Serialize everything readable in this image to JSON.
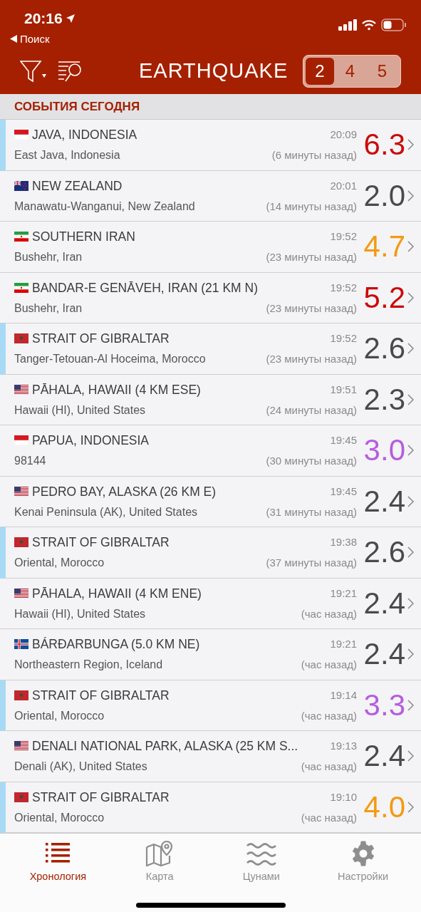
{
  "status_bar": {
    "time": "20:16",
    "back_label": "Поиск"
  },
  "header": {
    "title": "EARTHQUAKE",
    "magnitude_filter": [
      {
        "label": "2",
        "selected": true
      },
      {
        "label": "4",
        "selected": false
      },
      {
        "label": "5",
        "selected": false
      }
    ]
  },
  "section_title": "СОБЫТИЯ СЕГОДНЯ",
  "events": [
    {
      "kind": "id",
      "place": "JAVA, INDONESIA",
      "region": "East Java, Indonesia",
      "time": "20:09",
      "ago": "(6 минуты назад)",
      "magnitude": "6.3",
      "color": "#cc0a0a",
      "marked": true
    },
    {
      "kind": "nz",
      "place": "NEW ZEALAND",
      "region": "Manawatu-Wanganui, New Zealand",
      "time": "20:01",
      "ago": "(14 минуты назад)",
      "magnitude": "2.0",
      "color": "#4a4a4a",
      "marked": false
    },
    {
      "kind": "ir",
      "place": "SOUTHERN IRAN",
      "region": "Bushehr, Iran",
      "time": "19:52",
      "ago": "(23 минуты назад)",
      "magnitude": "4.7",
      "color": "#f39a12",
      "marked": false
    },
    {
      "kind": "ir",
      "place": "BANDAR-E GENĀVEH, IRAN (21 KM N)",
      "region": "Bushehr, Iran",
      "time": "19:52",
      "ago": "(23 минуты назад)",
      "magnitude": "5.2",
      "color": "#cc0a0a",
      "marked": false
    },
    {
      "kind": "ma",
      "place": "STRAIT OF GIBRALTAR",
      "region": "Tanger-Tetouan-Al Hoceima, Morocco",
      "time": "19:52",
      "ago": "(23 минуты назад)",
      "magnitude": "2.6",
      "color": "#4a4a4a",
      "marked": true
    },
    {
      "kind": "us",
      "place": "PĀHALA, HAWAII (4 KM ESE)",
      "region": "Hawaii (HI), United States",
      "time": "19:51",
      "ago": "(24 минуты назад)",
      "magnitude": "2.3",
      "color": "#4a4a4a",
      "marked": false
    },
    {
      "kind": "id",
      "place": "PAPUA, INDONESIA",
      "region": "98144",
      "time": "19:45",
      "ago": "(30 минуты назад)",
      "magnitude": "3.0",
      "color": "#b65ce0",
      "marked": false
    },
    {
      "kind": "us",
      "place": "PEDRO BAY, ALASKA (26 KM E)",
      "region": "Kenai Peninsula (AK), United States",
      "time": "19:45",
      "ago": "(31 минуты назад)",
      "magnitude": "2.4",
      "color": "#4a4a4a",
      "marked": false
    },
    {
      "kind": "ma",
      "place": "STRAIT OF GIBRALTAR",
      "region": "Oriental, Morocco",
      "time": "19:38",
      "ago": "(37 минуты назад)",
      "magnitude": "2.6",
      "color": "#4a4a4a",
      "marked": true
    },
    {
      "kind": "us",
      "place": "PĀHALA, HAWAII (4 KM ENE)",
      "region": "Hawaii (HI), United States",
      "time": "19:21",
      "ago": "(час назад)",
      "magnitude": "2.4",
      "color": "#4a4a4a",
      "marked": false
    },
    {
      "kind": "is",
      "place": "BÁRÐARBUNGA (5.0 KM NE)",
      "region": "Northeastern Region, Iceland",
      "time": "19:21",
      "ago": "(час назад)",
      "magnitude": "2.4",
      "color": "#4a4a4a",
      "marked": false
    },
    {
      "kind": "ma",
      "place": "STRAIT OF GIBRALTAR",
      "region": "Oriental, Morocco",
      "time": "19:14",
      "ago": "(час назад)",
      "magnitude": "3.3",
      "color": "#b65ce0",
      "marked": true
    },
    {
      "kind": "us",
      "place": "DENALI NATIONAL PARK, ALASKA (25 KM S...",
      "region": "Denali (AK), United States",
      "time": "19:13",
      "ago": "(час назад)",
      "magnitude": "2.4",
      "color": "#4a4a4a",
      "marked": false
    },
    {
      "kind": "ma",
      "place": "STRAIT OF GIBRALTAR",
      "region": "Oriental, Morocco",
      "time": "19:10",
      "ago": "(час назад)",
      "magnitude": "4.0",
      "color": "#f39a12",
      "marked": true
    }
  ],
  "tab_bar": [
    {
      "kind": "list",
      "label": "Хронология",
      "selected": true
    },
    {
      "kind": "map",
      "label": "Карта",
      "selected": false
    },
    {
      "kind": "waves",
      "label": "Цунами",
      "selected": false
    },
    {
      "kind": "gear",
      "label": "Настройки",
      "selected": false
    }
  ]
}
